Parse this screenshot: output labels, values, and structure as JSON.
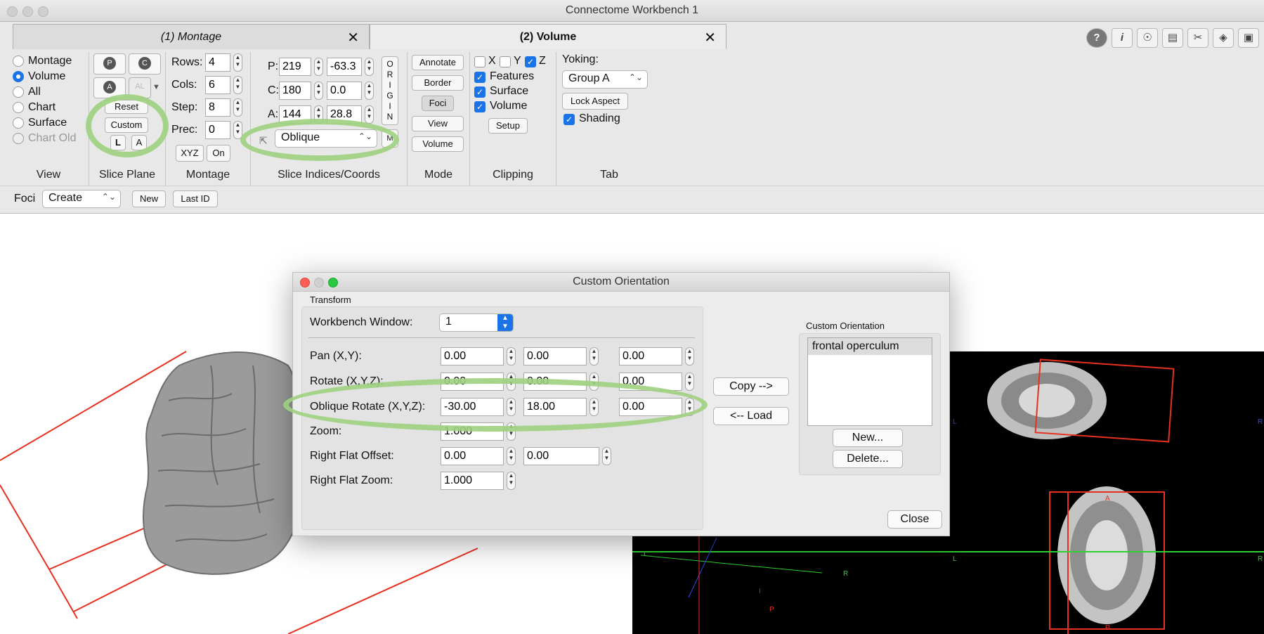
{
  "window": {
    "title": "Connectome Workbench 1"
  },
  "tabs": [
    {
      "label": "(1) Montage",
      "close": "✕"
    },
    {
      "label": "(2) Volume",
      "close": "✕"
    }
  ],
  "toolbar_icons": [
    "help-icon",
    "info-icon",
    "identify-icon",
    "movie-icon",
    "tools-icon",
    "layers-icon",
    "toolbox-icon"
  ],
  "view": {
    "section": "View",
    "options": [
      "Montage",
      "Volume",
      "All",
      "Chart",
      "Surface",
      "Chart Old"
    ],
    "selected": "Volume"
  },
  "slice_plane": {
    "section": "Slice Plane",
    "p_label": "P",
    "c_label": "C",
    "a_label": "A",
    "al_label": "AL",
    "reset": "Reset",
    "custom": "Custom",
    "l_label": "L",
    "a2_label": "A"
  },
  "montage": {
    "section": "Montage",
    "rows_label": "Rows:",
    "rows": "4",
    "cols_label": "Cols:",
    "cols": "6",
    "step_label": "Step:",
    "step": "8",
    "prec_label": "Prec:",
    "prec": "0",
    "xyz": "XYZ",
    "on": "On"
  },
  "slice_coords": {
    "section": "Slice Indices/Coords",
    "p_label": "P:",
    "p_index": "219",
    "p_coord": "-63.3",
    "c_label": "C:",
    "c_index": "180",
    "c_coord": "0.0",
    "a_label": "A:",
    "a_index": "144",
    "a_coord": "28.8",
    "origin": [
      "O",
      "R",
      "I",
      "G",
      "I",
      "N"
    ],
    "projection": "Oblique",
    "m_label": "M"
  },
  "mode": {
    "section": "Mode",
    "buttons": [
      "Annotate",
      "Border",
      "Foci",
      "View",
      "Volume"
    ]
  },
  "clipping": {
    "section": "Clipping",
    "x": "X",
    "y": "Y",
    "z": "Z",
    "features": "Features",
    "surface": "Surface",
    "volume": "Volume",
    "setup": "Setup"
  },
  "tab_section": {
    "section": "Tab",
    "yoking_label": "Yoking:",
    "yoking": "Group A",
    "lock_aspect": "Lock Aspect",
    "shading": "Shading"
  },
  "foci_bar": {
    "label": "Foci",
    "mode": "Create",
    "new": "New",
    "last_id": "Last ID"
  },
  "dialog": {
    "title": "Custom Orientation",
    "transform_label": "Transform",
    "workbench_window_label": "Workbench Window:",
    "workbench_window": "1",
    "pan_label": "Pan (X,Y):",
    "pan": [
      "0.00",
      "0.00",
      "0.00"
    ],
    "rotate_label": "Rotate (X,Y,Z):",
    "rotate": [
      "0.00",
      "0.00",
      "0.00"
    ],
    "oblique_label": "Oblique Rotate (X,Y,Z):",
    "oblique": [
      "-30.00",
      "18.00",
      "0.00"
    ],
    "zoom_label": "Zoom:",
    "zoom": "1.000",
    "rf_offset_label": "Right Flat Offset:",
    "rf_offset": [
      "0.00",
      "0.00"
    ],
    "rf_zoom_label": "Right Flat Zoom:",
    "rf_zoom": "1.000",
    "copy_btn": "Copy -->",
    "load_btn": "<-- Load",
    "custom_orientation_label": "Custom Orientation",
    "orientations": [
      "frontal operculum"
    ],
    "new_btn": "New...",
    "delete_btn": "Delete...",
    "close_btn": "Close"
  },
  "viewer_labels": {
    "l": "L",
    "r": "R",
    "a": "A",
    "p": "P",
    "i": "I"
  },
  "colors": {
    "highlight": "#9ed07f",
    "accent": "#1a74e8",
    "plane_red": "#e8301f",
    "axis_green": "#2ed12e"
  }
}
